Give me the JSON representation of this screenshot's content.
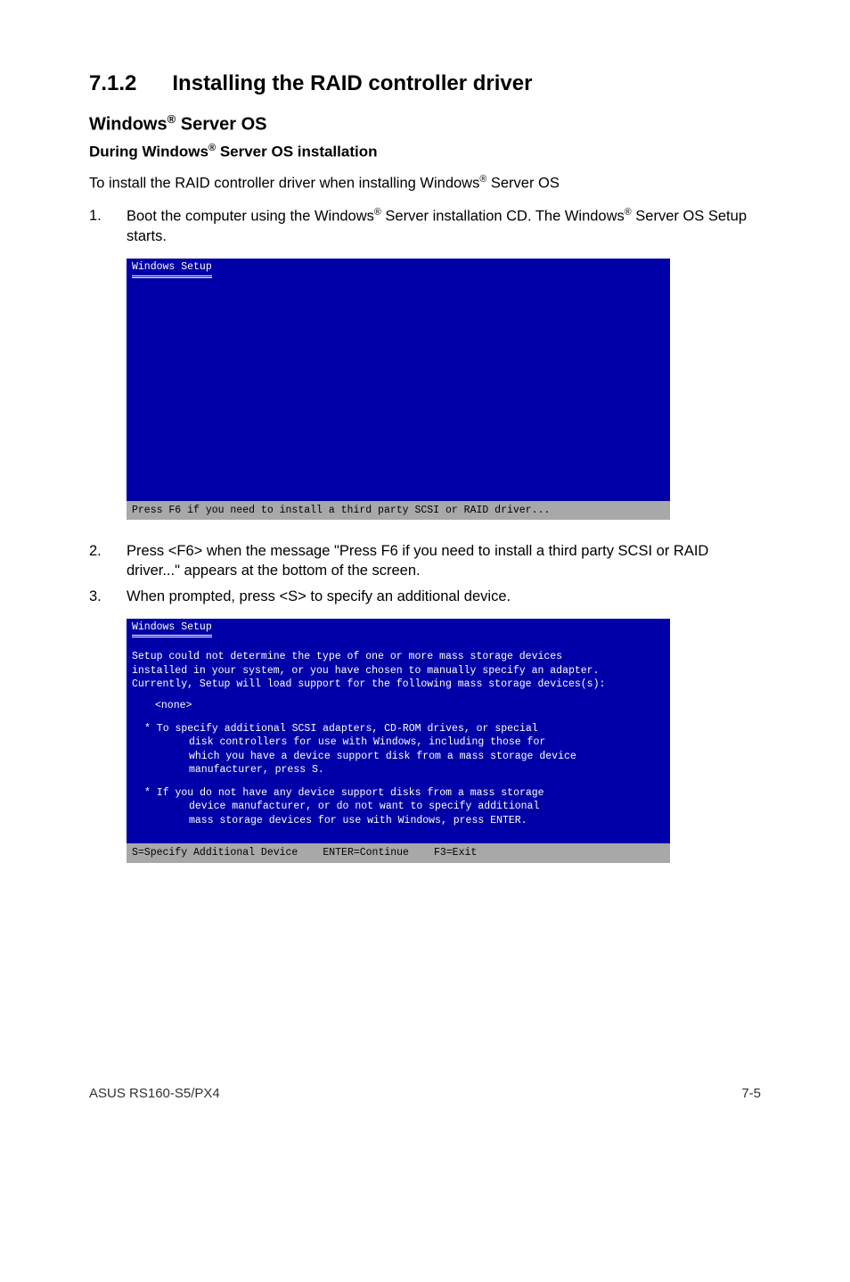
{
  "heading": {
    "number": "7.1.2",
    "title": "Installing the RAID controller driver"
  },
  "sub": {
    "title_pre": "Windows",
    "title_sup": "®",
    "title_post": " Server OS",
    "sub_pre": "During Windows",
    "sub_sup": "®",
    "sub_post": " Server OS installation"
  },
  "intro": {
    "pre": "To install the RAID controller driver when installing Windows",
    "sup": "®",
    "post": " Server OS"
  },
  "steps": [
    {
      "num": "1.",
      "pre": "Boot the computer using the Windows",
      "sup1": "®",
      "mid": " Server installation CD. The Windows",
      "sup2": "®",
      "post": " Server OS Setup starts."
    },
    {
      "num": "2.",
      "text": "Press <F6> when the message \"Press F6 if you need to install a third party SCSI or RAID driver...\" appears at the bottom of the screen."
    },
    {
      "num": "3.",
      "text": "When prompted, press <S> to specify an additional device."
    }
  ],
  "term1": {
    "title": "Windows Setup",
    "bottom": "Press F6 if you need to install a third party SCSI or RAID driver..."
  },
  "term2": {
    "title": "Windows Setup",
    "line1": "Setup could not determine the type of one or more mass storage devices",
    "line2": "installed in your system, or you have chosen to manually specify an adapter.",
    "line3": "Currently, Setup will load support for the following mass storage devices(s):",
    "none": "<none>",
    "b1a": "* To specify additional SCSI adapters, CD-ROM drives, or special",
    "b1b": "disk controllers for use with Windows, including those for",
    "b1c": "which you have a device support disk from a mass storage device",
    "b1d": "manufacturer, press S.",
    "b2a": "* If you do not have any device support disks from a mass storage",
    "b2b": "device manufacturer, or do not want to specify additional",
    "b2c": "mass storage devices for use with Windows, press ENTER.",
    "status_a": "S=Specify Additional Device",
    "status_b": "ENTER=Continue",
    "status_c": "F3=Exit"
  },
  "footer": {
    "left": "ASUS RS160-S5/PX4",
    "right": "7-5"
  }
}
